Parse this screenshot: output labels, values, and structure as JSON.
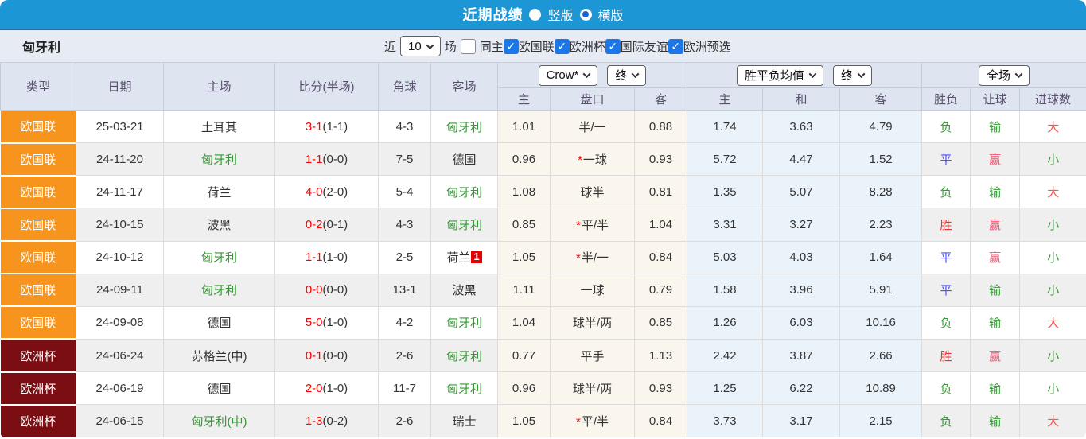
{
  "topbar": {
    "title": "近期战绩",
    "layout_options": [
      {
        "label": "竖版",
        "selected": false
      },
      {
        "label": "横版",
        "selected": true
      }
    ]
  },
  "filter": {
    "team": "匈牙利",
    "near_label": "近",
    "games_value": "10",
    "games_suffix": "场",
    "same_home_label": "同主",
    "same_home_checked": false,
    "leagues": [
      {
        "label": "欧国联",
        "checked": true
      },
      {
        "label": "欧洲杯",
        "checked": true
      },
      {
        "label": "国际友谊",
        "checked": true
      },
      {
        "label": "欧洲预选",
        "checked": true
      }
    ]
  },
  "table": {
    "selects": {
      "company": "Crow*",
      "company_stage": "终",
      "avg": "胜平负均值",
      "avg_stage": "终",
      "scope": "全场"
    },
    "columns": [
      "类型",
      "日期",
      "主场",
      "比分(半场)",
      "角球",
      "客场"
    ],
    "sub_columns": [
      "主",
      "盘口",
      "客",
      "主",
      "和",
      "客",
      "胜负",
      "让球",
      "进球数"
    ],
    "type_colors": {
      "欧国联": "#F7941E",
      "欧洲杯": "#7A0E12"
    },
    "colors": {
      "topbar": "#1C96D5",
      "green": "#339933",
      "red": "#E63434",
      "blue": "#5050EE",
      "pink": "#F0506E",
      "light_red": "#FF5148",
      "score_red": "#FF0000",
      "odds_bg": "#FAF6EE",
      "avg_bg": "#EBF3FA",
      "checkbox_blue": "#1B76E8"
    },
    "rows": [
      {
        "type": "欧国联",
        "date": "25-03-21",
        "home": "土耳其",
        "home_green": false,
        "score": "3-1",
        "half": "(1-1)",
        "corner": "4-3",
        "away": "匈牙利",
        "away_green": true,
        "away_redcard": "",
        "odds_home": "1.01",
        "handicap_star": false,
        "handicap": "半/一",
        "odds_away": "0.88",
        "avg_home": "1.74",
        "avg_draw": "3.63",
        "avg_away": "4.79",
        "result": {
          "text": "负",
          "c": "green"
        },
        "let": {
          "text": "输",
          "c": "green"
        },
        "goals": {
          "text": "大",
          "c": "lred"
        }
      },
      {
        "type": "欧国联",
        "date": "24-11-20",
        "home": "匈牙利",
        "home_green": true,
        "score": "1-1",
        "half": "(0-0)",
        "corner": "7-5",
        "away": "德国",
        "away_green": false,
        "away_redcard": "",
        "odds_home": "0.96",
        "handicap_star": true,
        "handicap": "一球",
        "odds_away": "0.93",
        "avg_home": "5.72",
        "avg_draw": "4.47",
        "avg_away": "1.52",
        "result": {
          "text": "平",
          "c": "blue"
        },
        "let": {
          "text": "赢",
          "c": "pink"
        },
        "goals": {
          "text": "小",
          "c": "green"
        }
      },
      {
        "type": "欧国联",
        "date": "24-11-17",
        "home": "荷兰",
        "home_green": false,
        "score": "4-0",
        "half": "(2-0)",
        "corner": "5-4",
        "away": "匈牙利",
        "away_green": true,
        "away_redcard": "",
        "odds_home": "1.08",
        "handicap_star": false,
        "handicap": "球半",
        "odds_away": "0.81",
        "avg_home": "1.35",
        "avg_draw": "5.07",
        "avg_away": "8.28",
        "result": {
          "text": "负",
          "c": "green"
        },
        "let": {
          "text": "输",
          "c": "green"
        },
        "goals": {
          "text": "大",
          "c": "lred"
        }
      },
      {
        "type": "欧国联",
        "date": "24-10-15",
        "home": "波黑",
        "home_green": false,
        "score": "0-2",
        "half": "(0-1)",
        "corner": "4-3",
        "away": "匈牙利",
        "away_green": true,
        "away_redcard": "",
        "odds_home": "0.85",
        "handicap_star": true,
        "handicap": "平/半",
        "odds_away": "1.04",
        "avg_home": "3.31",
        "avg_draw": "3.27",
        "avg_away": "2.23",
        "result": {
          "text": "胜",
          "c": "red"
        },
        "let": {
          "text": "赢",
          "c": "pink"
        },
        "goals": {
          "text": "小",
          "c": "green"
        }
      },
      {
        "type": "欧国联",
        "date": "24-10-12",
        "home": "匈牙利",
        "home_green": true,
        "score": "1-1",
        "half": "(1-0)",
        "corner": "2-5",
        "away": "荷兰",
        "away_green": false,
        "away_redcard": "1",
        "odds_home": "1.05",
        "handicap_star": true,
        "handicap": "半/一",
        "odds_away": "0.84",
        "avg_home": "5.03",
        "avg_draw": "4.03",
        "avg_away": "1.64",
        "result": {
          "text": "平",
          "c": "blue"
        },
        "let": {
          "text": "赢",
          "c": "pink"
        },
        "goals": {
          "text": "小",
          "c": "green"
        }
      },
      {
        "type": "欧国联",
        "date": "24-09-11",
        "home": "匈牙利",
        "home_green": true,
        "score": "0-0",
        "half": "(0-0)",
        "corner": "13-1",
        "away": "波黑",
        "away_green": false,
        "away_redcard": "",
        "odds_home": "1.11",
        "handicap_star": false,
        "handicap": "一球",
        "odds_away": "0.79",
        "avg_home": "1.58",
        "avg_draw": "3.96",
        "avg_away": "5.91",
        "result": {
          "text": "平",
          "c": "blue"
        },
        "let": {
          "text": "输",
          "c": "green"
        },
        "goals": {
          "text": "小",
          "c": "green"
        }
      },
      {
        "type": "欧国联",
        "date": "24-09-08",
        "home": "德国",
        "home_green": false,
        "score": "5-0",
        "half": "(1-0)",
        "corner": "4-2",
        "away": "匈牙利",
        "away_green": true,
        "away_redcard": "",
        "odds_home": "1.04",
        "handicap_star": false,
        "handicap": "球半/两",
        "odds_away": "0.85",
        "avg_home": "1.26",
        "avg_draw": "6.03",
        "avg_away": "10.16",
        "result": {
          "text": "负",
          "c": "green"
        },
        "let": {
          "text": "输",
          "c": "green"
        },
        "goals": {
          "text": "大",
          "c": "lred"
        }
      },
      {
        "type": "欧洲杯",
        "date": "24-06-24",
        "home": "苏格兰(中)",
        "home_green": false,
        "score": "0-1",
        "half": "(0-0)",
        "corner": "2-6",
        "away": "匈牙利",
        "away_green": true,
        "away_redcard": "",
        "odds_home": "0.77",
        "handicap_star": false,
        "handicap": "平手",
        "odds_away": "1.13",
        "avg_home": "2.42",
        "avg_draw": "3.87",
        "avg_away": "2.66",
        "result": {
          "text": "胜",
          "c": "red"
        },
        "let": {
          "text": "赢",
          "c": "pink"
        },
        "goals": {
          "text": "小",
          "c": "green"
        }
      },
      {
        "type": "欧洲杯",
        "date": "24-06-19",
        "home": "德国",
        "home_green": false,
        "score": "2-0",
        "half": "(1-0)",
        "corner": "11-7",
        "away": "匈牙利",
        "away_green": true,
        "away_redcard": "",
        "odds_home": "0.96",
        "handicap_star": false,
        "handicap": "球半/两",
        "odds_away": "0.93",
        "avg_home": "1.25",
        "avg_draw": "6.22",
        "avg_away": "10.89",
        "result": {
          "text": "负",
          "c": "green"
        },
        "let": {
          "text": "输",
          "c": "green"
        },
        "goals": {
          "text": "小",
          "c": "green"
        }
      },
      {
        "type": "欧洲杯",
        "date": "24-06-15",
        "home": "匈牙利(中)",
        "home_green": true,
        "score": "1-3",
        "half": "(0-2)",
        "corner": "2-6",
        "away": "瑞士",
        "away_green": false,
        "away_redcard": "",
        "odds_home": "1.05",
        "handicap_star": true,
        "handicap": "平/半",
        "odds_away": "0.84",
        "avg_home": "3.73",
        "avg_draw": "3.17",
        "avg_away": "2.15",
        "result": {
          "text": "负",
          "c": "green"
        },
        "let": {
          "text": "输",
          "c": "green"
        },
        "goals": {
          "text": "大",
          "c": "lred"
        }
      }
    ]
  }
}
